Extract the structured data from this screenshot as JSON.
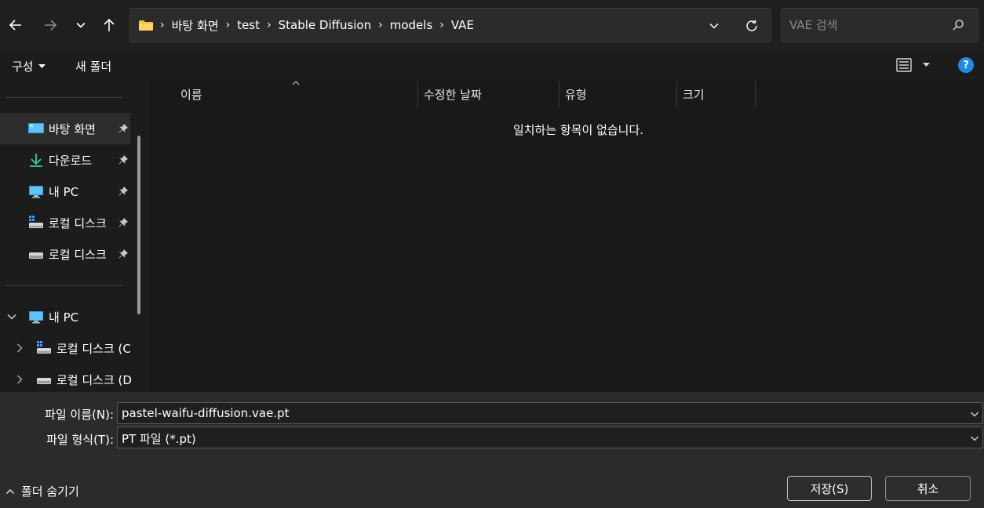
{
  "address": {
    "crumbs": [
      "바탕 화면",
      "test",
      "Stable Diffusion",
      "models",
      "VAE"
    ]
  },
  "search": {
    "placeholder": "VAE 검색"
  },
  "toolbar": {
    "organize_label": "구성",
    "new_folder_label": "새 폴더",
    "help_label": "?"
  },
  "nav": {
    "quick_access": [
      {
        "label": "바탕 화면",
        "icon": "desktop-icon"
      },
      {
        "label": "다운로드",
        "icon": "download-icon"
      },
      {
        "label": "내 PC",
        "icon": "pc-icon"
      },
      {
        "label": "로컬 디스크",
        "icon": "drive-windows-icon"
      },
      {
        "label": "로컬 디스크",
        "icon": "drive-icon"
      }
    ],
    "tree": [
      {
        "label": "내 PC",
        "icon": "pc-icon"
      },
      {
        "label": "로컬 디스크 (C",
        "icon": "drive-windows-icon"
      },
      {
        "label": "로컬 디스크 (D",
        "icon": "drive-icon"
      }
    ]
  },
  "columns": [
    "이름",
    "수정한 날짜",
    "유형",
    "크기"
  ],
  "empty_message": "일치하는 항목이 없습니다.",
  "bottom": {
    "filename_label": "파일 이름(N):",
    "filename_value": "pastel-waifu-diffusion.vae.pt",
    "filetype_label": "파일 형식(T):",
    "filetype_value": "PT 파일 (*.pt)",
    "hide_folders_label": "폴더 숨기기",
    "save_label": "저장(S)",
    "cancel_label": "취소"
  },
  "colors": {
    "accent": "#1e88e5",
    "folder": "#f3c341",
    "background": "#191919",
    "panel": "#2b2b2b"
  }
}
